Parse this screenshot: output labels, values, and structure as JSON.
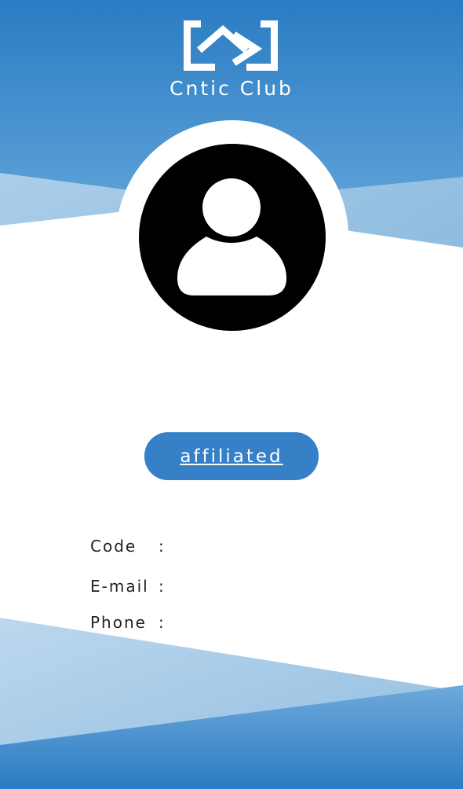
{
  "header": {
    "logo_icon": "cntic-logo-icon",
    "club_name": "Cntic Club"
  },
  "profile": {
    "avatar_icon": "user-avatar-icon",
    "status_label": "affiliated"
  },
  "info": {
    "code_label": "Code",
    "email_label": "E-mail",
    "phone_label": "Phone",
    "separator": ":",
    "code_value": "",
    "email_value": "",
    "phone_value": ""
  },
  "colors": {
    "primary_blue": "#2f7fc4",
    "light_blue": "#a9cbe8",
    "white": "#ffffff"
  }
}
